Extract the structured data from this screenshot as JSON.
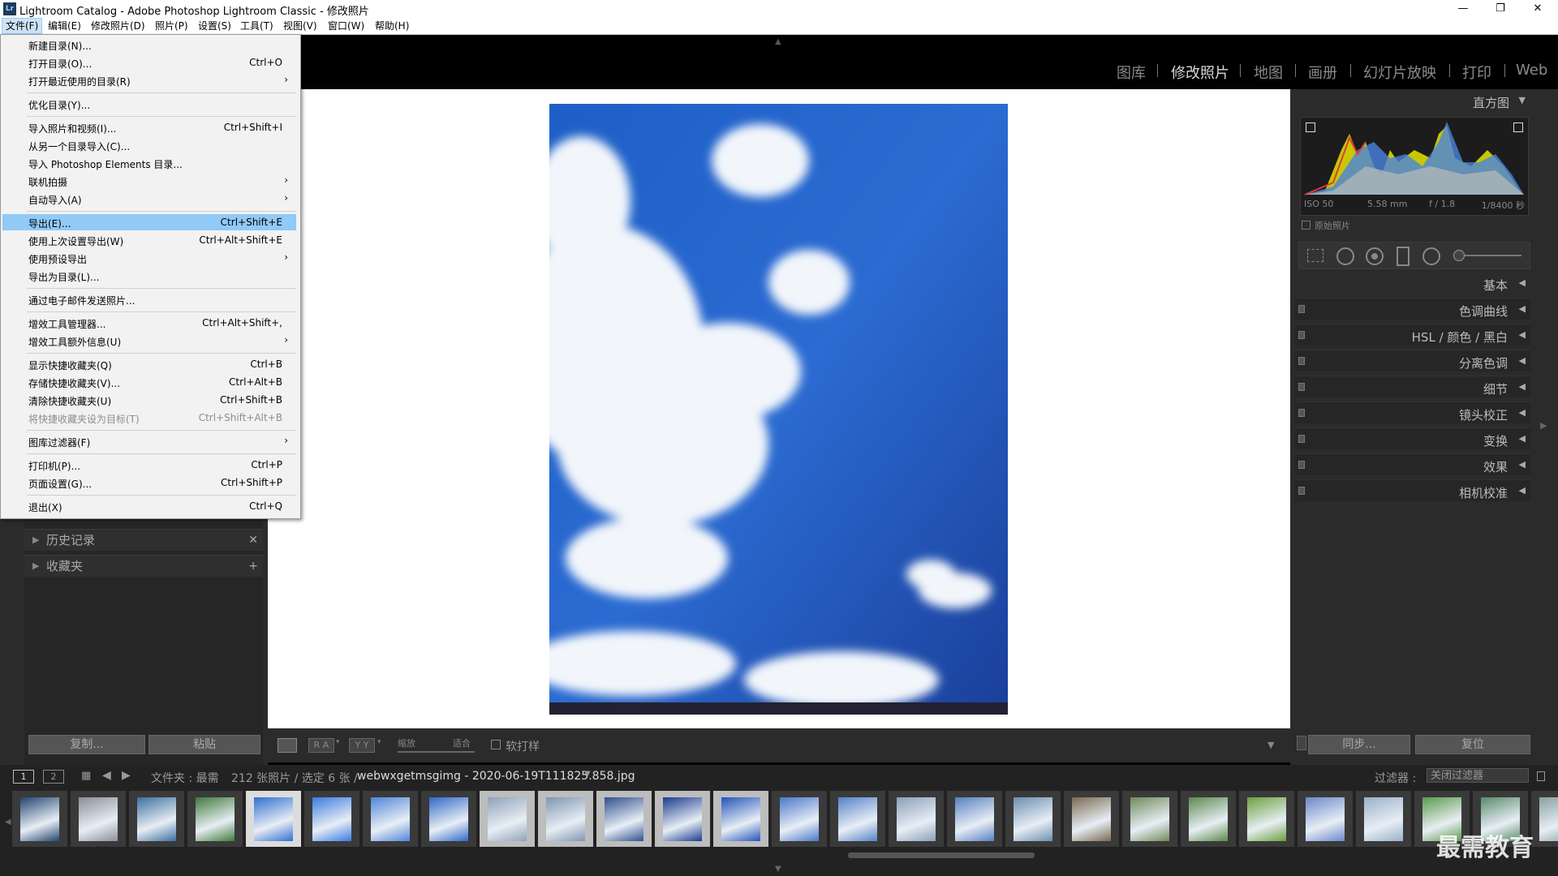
{
  "window": {
    "title": "Lightroom Catalog - Adobe Photoshop Lightroom Classic - 修改照片",
    "logo": "Lr",
    "minimize": "—",
    "restore": "❐",
    "close": "✕"
  },
  "menubar": [
    "文件(F)",
    "编辑(E)",
    "修改照片(D)",
    "照片(P)",
    "设置(S)",
    "工具(T)",
    "视图(V)",
    "窗口(W)",
    "帮助(H)"
  ],
  "modules": [
    "图库",
    "修改照片",
    "地图",
    "画册",
    "幻灯片放映",
    "打印",
    "Web"
  ],
  "file_menu": [
    {
      "label": "新建目录(N)...",
      "shortcut": ""
    },
    {
      "label": "打开目录(O)...",
      "shortcut": "Ctrl+O"
    },
    {
      "label": "打开最近使用的目录(R)",
      "shortcut": "",
      "submenu": true
    },
    {
      "sep": true
    },
    {
      "label": "优化目录(Y)...",
      "shortcut": ""
    },
    {
      "sep": true
    },
    {
      "label": "导入照片和视频(I)...",
      "shortcut": "Ctrl+Shift+I"
    },
    {
      "label": "从另一个目录导入(C)...",
      "shortcut": ""
    },
    {
      "label": "导入 Photoshop Elements 目录...",
      "shortcut": ""
    },
    {
      "label": "联机拍摄",
      "shortcut": "",
      "submenu": true
    },
    {
      "label": "自动导入(A)",
      "shortcut": "",
      "submenu": true
    },
    {
      "sep": true
    },
    {
      "label": "导出(E)...",
      "shortcut": "Ctrl+Shift+E",
      "highlight": true
    },
    {
      "label": "使用上次设置导出(W)",
      "shortcut": "Ctrl+Alt+Shift+E"
    },
    {
      "label": "使用预设导出",
      "shortcut": "",
      "submenu": true
    },
    {
      "label": "导出为目录(L)...",
      "shortcut": ""
    },
    {
      "sep": true
    },
    {
      "label": "通过电子邮件发送照片...",
      "shortcut": ""
    },
    {
      "sep": true
    },
    {
      "label": "增效工具管理器...",
      "shortcut": "Ctrl+Alt+Shift+,"
    },
    {
      "label": "增效工具额外信息(U)",
      "shortcut": "",
      "submenu": true
    },
    {
      "sep": true
    },
    {
      "label": "显示快捷收藏夹(Q)",
      "shortcut": "Ctrl+B"
    },
    {
      "label": "存储快捷收藏夹(V)...",
      "shortcut": "Ctrl+Alt+B"
    },
    {
      "label": "清除快捷收藏夹(U)",
      "shortcut": "Ctrl+Shift+B"
    },
    {
      "label": "将快捷收藏夹设为目标(T)",
      "shortcut": "Ctrl+Shift+Alt+B",
      "disabled": true
    },
    {
      "sep": true
    },
    {
      "label": "图库过滤器(F)",
      "shortcut": "",
      "submenu": true
    },
    {
      "sep": true
    },
    {
      "label": "打印机(P)...",
      "shortcut": "Ctrl+P"
    },
    {
      "label": "页面设置(G)...",
      "shortcut": "Ctrl+Shift+P"
    },
    {
      "sep": true
    },
    {
      "label": "退出(X)",
      "shortcut": "Ctrl+Q"
    }
  ],
  "left_panels": {
    "history": "历史记录",
    "collections": "收藏夹",
    "history_close": "✕",
    "collections_add": "+",
    "copy_button": "复制...",
    "paste_button": "粘贴"
  },
  "histogram": {
    "title": "直方图",
    "iso": "ISO 50",
    "focal": "5.58 mm",
    "aperture": "f / 1.8",
    "shutter": "1/8400 秒",
    "original_photo": "原始照片"
  },
  "right_sections": [
    "基本",
    "色调曲线",
    "HSL / 颜色 / 黑白",
    "分离色调",
    "细节",
    "镜头校正",
    "变换",
    "效果",
    "相机校准"
  ],
  "right_buttons": {
    "sync": "同步...",
    "reset": "复位"
  },
  "toolbar": {
    "zoom_label": "缩放",
    "fit_label": "适合",
    "soft_proof": "软打样",
    "ra": "R A",
    "yy": "Y Y"
  },
  "filmstrip": {
    "screen1": "1",
    "screen2": "2",
    "source": "文件夹 : 最需",
    "count": "212 张照片 / 选定 6 张 /",
    "filename": "webwxgetmsgimg - 2020-06-19T111825.858.jpg",
    "filter_label": "过滤器 :",
    "filter_value": "关闭过滤器",
    "watermark": "最需教育"
  },
  "colors": {
    "accent_highlight": "#91c9f7",
    "panel_bg": "#2b2b2b",
    "sky": "#2c66c9"
  }
}
